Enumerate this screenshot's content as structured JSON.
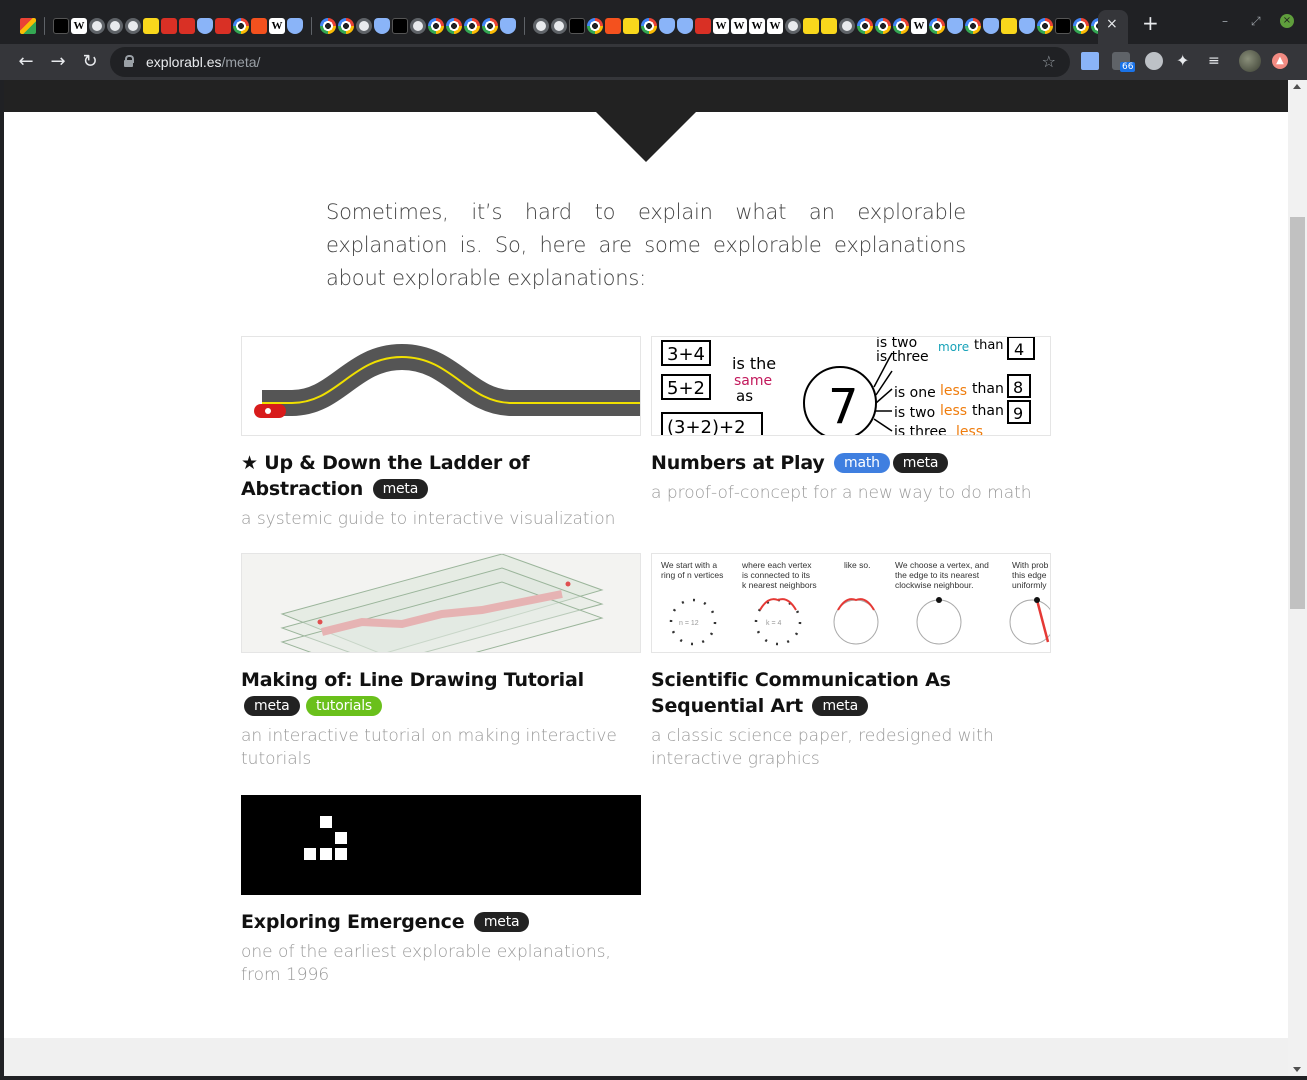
{
  "browser": {
    "tab_close_label": "×",
    "new_tab_label": "+",
    "minimize_label": "–",
    "restore_label": "⤢",
    "close_label": "×",
    "back_icon": "←",
    "forward_icon": "→",
    "reload_icon": "↻",
    "url_host": "explorabl.es",
    "url_path": "/meta/",
    "bookmark_icon": "☆",
    "extensions_icon": "✦",
    "queue_icon": "≡",
    "extension_badge": "66",
    "update_icon": "▲"
  },
  "page": {
    "intro": "Sometimes, it’s hard to explain what an explorable explanation is. So, here are some explorable explanations about explorable explanations:",
    "cards": [
      {
        "title": "★ Up & Down the Ladder of Abstraction",
        "tags": [
          "meta"
        ],
        "desc": "a systemic guide to interactive visualization"
      },
      {
        "title": "Numbers at Play",
        "tags": [
          "math",
          "meta"
        ],
        "desc": "a proof-of-concept for a new way to do math",
        "thumb_text": {
          "n1": "3+4",
          "n2": "5+2",
          "n3": "(3+2)+2",
          "is_the": "is the",
          "same": "same",
          "as": "as",
          "center": "7",
          "r1": "is two",
          "r2": "is three",
          "more": "more",
          "than": "than",
          "v4": "4",
          "r3": "is one",
          "less": "less",
          "v8": "8",
          "r4": "is two",
          "v9": "9",
          "r5": "is three"
        }
      },
      {
        "title": "Making of: Line Drawing Tutorial",
        "tags": [
          "meta",
          "tutorials"
        ],
        "desc": "an interactive tutorial on making interactive tutorials"
      },
      {
        "title": "Scientific Communication As Sequential Art",
        "tags": [
          "meta"
        ],
        "desc": "a classic science paper, redesigned with interactive graphics",
        "thumb_text": {
          "p1a": "We start with a",
          "p1b": "ring of n vertices",
          "p2a": "where each vertex",
          "p2b": "is connected to its",
          "p2c": "k nearest neighbors",
          "p3a": "like so.",
          "p4a": "We choose a vertex, and",
          "p4b": "the edge to its nearest",
          "p4c": "clockwise neighbour.",
          "p5a": "With prob",
          "p5b": "this edge",
          "p5c": "uniformly",
          "n_label": "n = 12",
          "k_label": "k = 4"
        }
      },
      {
        "title": "Exploring Emergence",
        "tags": [
          "meta"
        ],
        "desc": "one of the earliest explorable explanations, from 1996"
      }
    ]
  },
  "colors": {
    "tag_default": "#222222",
    "tag_math": "#3f7fe0",
    "tag_tutorials": "#6ac01b",
    "road": "#555555",
    "road_line": "#f0e000",
    "car": "#d81b1b"
  }
}
